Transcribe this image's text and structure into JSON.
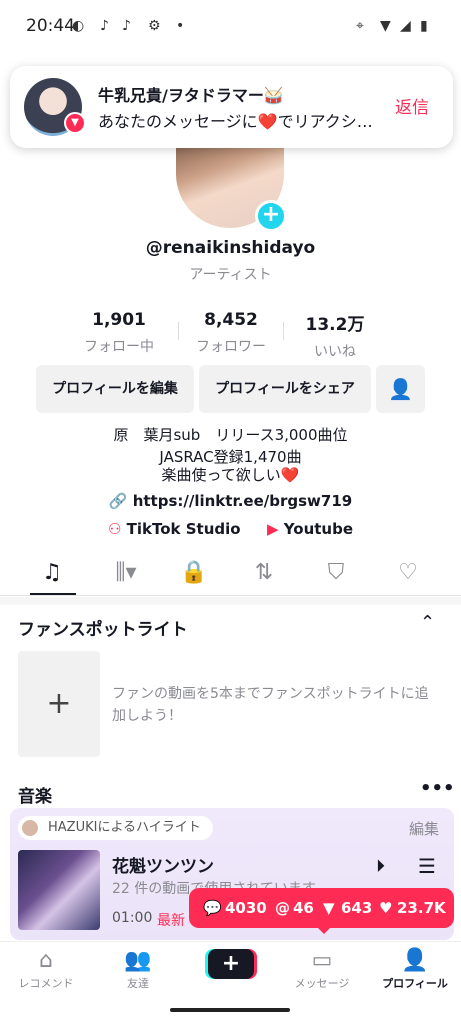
{
  "status_bar": {
    "time": "20:44",
    "icons": [
      "line-icon",
      "tiktok-icon",
      "tiktok-icon",
      "gear-icon",
      "dot-icon",
      "location-icon",
      "wifi-icon",
      "signal-icon",
      "battery-icon"
    ]
  },
  "notification": {
    "sender": "牛乳兄貴/ヲタドラマー🥁",
    "message": "あなたのメッセージに❤️でリアクシ…",
    "reply": "返信"
  },
  "profile": {
    "username": "@renaikinshidayo",
    "role": "アーティスト",
    "stats": [
      {
        "value": "1,901",
        "label": "フォロー中"
      },
      {
        "value": "8,452",
        "label": "フォロワー"
      },
      {
        "value": "13.2万",
        "label": "いいね"
      }
    ],
    "buttons": {
      "edit": "プロフィールを編集",
      "share": "プロフィールをシェア"
    },
    "bio": [
      "原　葉月sub　リリース3,000曲位",
      "JASRAC登録1,470曲",
      "楽曲使って欲しい❤️"
    ],
    "link": "https://linktr.ee/brgsw719",
    "external": [
      {
        "label": "TikTok Studio"
      },
      {
        "label": "Youtube"
      }
    ]
  },
  "tabs": [
    "music-icon",
    "sort-icon",
    "lock-icon",
    "repost-icon",
    "bookmark-icon",
    "liked-icon"
  ],
  "fan_spotlight": {
    "title": "ファンスポットライト",
    "description": "ファンの動画を5本までファンスポットライトに追加しよう！"
  },
  "music": {
    "title": "音楽",
    "highlight": "HAZUKIによるハイライト",
    "edit": "編集",
    "song_title": "花魁ツンツン",
    "song_sub": "22 件の動画で使用されています",
    "duration": "01:00",
    "newest": "最新"
  },
  "reactions": {
    "comments": "4030",
    "mentions": "46",
    "shares": "643",
    "likes": "23.7K"
  },
  "nav": [
    {
      "label": "レコメンド"
    },
    {
      "label": "友達"
    },
    {
      "label": ""
    },
    {
      "label": "メッセージ"
    },
    {
      "label": "プロフィール"
    }
  ],
  "colors": {
    "accent": "#fe2c55",
    "cyan": "#20d5ec"
  }
}
